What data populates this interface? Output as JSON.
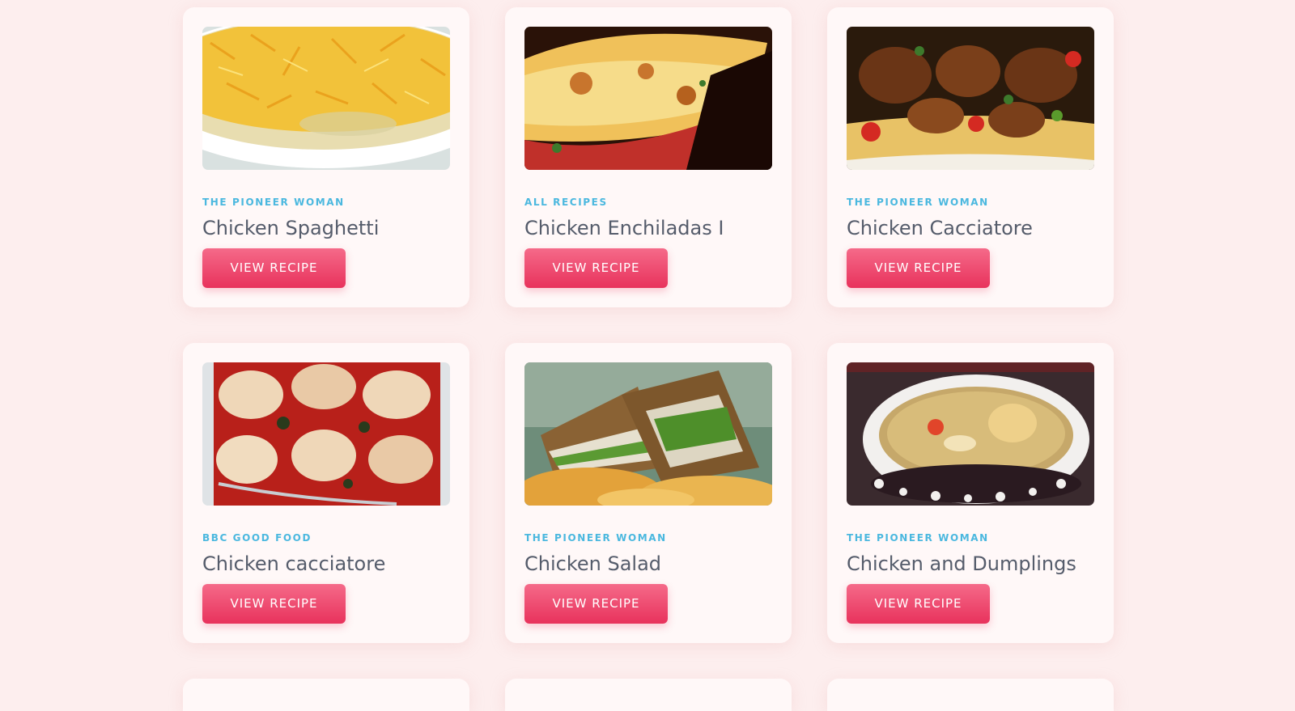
{
  "recipes": [
    {
      "source": "THE PIONEER WOMAN",
      "title": "Chicken Spaghetti",
      "button": "VIEW RECIPE",
      "image": "chicken-spaghetti-photo"
    },
    {
      "source": "ALL RECIPES",
      "title": "Chicken Enchiladas I",
      "button": "VIEW RECIPE",
      "image": "chicken-enchiladas-photo"
    },
    {
      "source": "THE PIONEER WOMAN",
      "title": "Chicken Cacciatore",
      "button": "VIEW RECIPE",
      "image": "chicken-cacciatore-photo"
    },
    {
      "source": "BBC GOOD FOOD",
      "title": "Chicken cacciatore",
      "button": "VIEW RECIPE",
      "image": "chicken-cacciatore-bake-photo"
    },
    {
      "source": "THE PIONEER WOMAN",
      "title": "Chicken Salad",
      "button": "VIEW RECIPE",
      "image": "chicken-salad-sandwich-photo"
    },
    {
      "source": "THE PIONEER WOMAN",
      "title": "Chicken and Dumplings",
      "button": "VIEW RECIPE",
      "image": "chicken-and-dumplings-photo"
    }
  ],
  "colors": {
    "background": "#fdeeee",
    "card": "#fff8f8",
    "source": "#4bb8df",
    "title": "#555c6b",
    "button_top": "#f56a89",
    "button_bottom": "#e8325c"
  }
}
